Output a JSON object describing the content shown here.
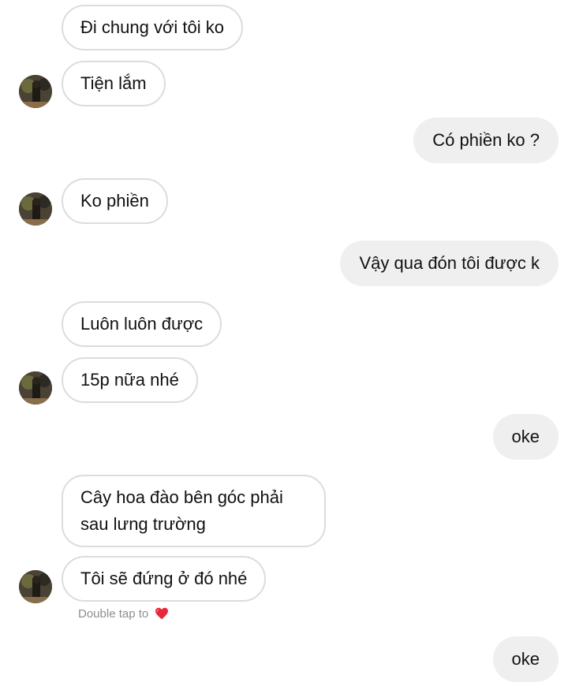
{
  "messages": [
    {
      "from": "them",
      "text": "Đi chung với tôi ko"
    },
    {
      "from": "them",
      "text": "Tiện lắm"
    },
    {
      "from": "me",
      "text": "Có phiền ko ?"
    },
    {
      "from": "them",
      "text": "Ko phiền"
    },
    {
      "from": "me",
      "text": "Vậy qua đón tôi được k"
    },
    {
      "from": "them",
      "text": "Luôn luôn được"
    },
    {
      "from": "them",
      "text": "15p nữa nhé"
    },
    {
      "from": "me",
      "text": "oke"
    },
    {
      "from": "them",
      "line1": "Cây hoa đào bên góc phải",
      "line2": "sau lưng trường"
    },
    {
      "from": "them",
      "text": "Tôi sẽ đứng ở đó nhé"
    },
    {
      "from": "me",
      "text": "oke"
    }
  ],
  "hint": {
    "text": "Double tap to",
    "icon": "heart-icon",
    "icon_color": "#e8283a"
  },
  "colors": {
    "sent_bg": "#efefef",
    "recv_border": "#dcdcdc"
  }
}
